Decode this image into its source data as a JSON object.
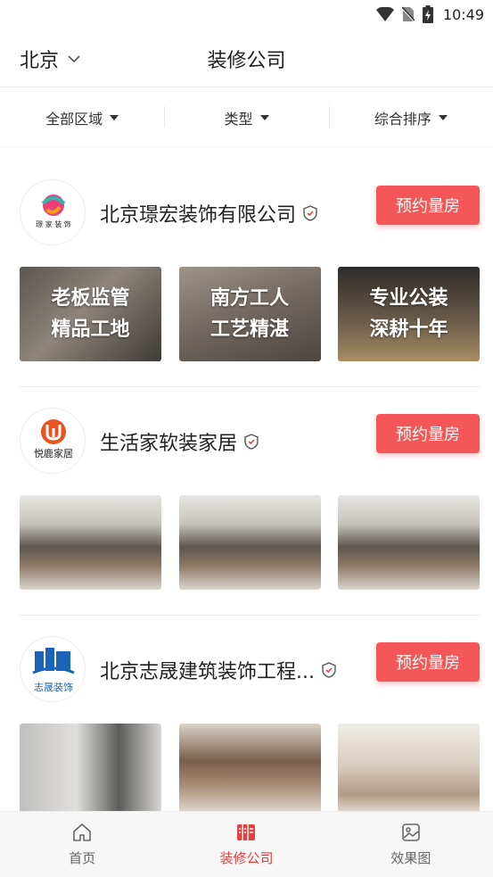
{
  "status": {
    "time": "10:49",
    "icons": [
      "wifi-icon",
      "no-sim-icon",
      "battery-charging-icon"
    ]
  },
  "header": {
    "city": "北京",
    "title": "装修公司"
  },
  "filters": [
    {
      "label": "全部区域"
    },
    {
      "label": "类型"
    },
    {
      "label": "综合排序"
    }
  ],
  "companies": [
    {
      "name": "北京璟宏装饰有限公司",
      "logo_text": "璟 家 装 饰",
      "button": "预约量房",
      "thumbs": [
        {
          "caption": "老板监管\n精品工地"
        },
        {
          "caption": "南方工人\n工艺精湛"
        },
        {
          "caption": "专业公装\n深耕十年"
        }
      ]
    },
    {
      "name": "生活家软装家居",
      "logo_text": "悦鹿家居",
      "button": "预约量房",
      "thumbs": [
        {
          "caption": ""
        },
        {
          "caption": ""
        },
        {
          "caption": ""
        }
      ]
    },
    {
      "name": "北京志晟建筑装饰工程...",
      "logo_text": "志晟装饰",
      "button": "预约量房",
      "thumbs": [
        {
          "caption": ""
        },
        {
          "caption": ""
        },
        {
          "caption": ""
        }
      ]
    }
  ],
  "tabs": [
    {
      "label": "首页",
      "icon": "home-icon",
      "active": false
    },
    {
      "label": "装修公司",
      "icon": "company-icon",
      "active": true
    },
    {
      "label": "效果图",
      "icon": "gallery-icon",
      "active": false
    }
  ],
  "colors": {
    "accent": "#f45757",
    "active_tab": "#e9403f"
  }
}
